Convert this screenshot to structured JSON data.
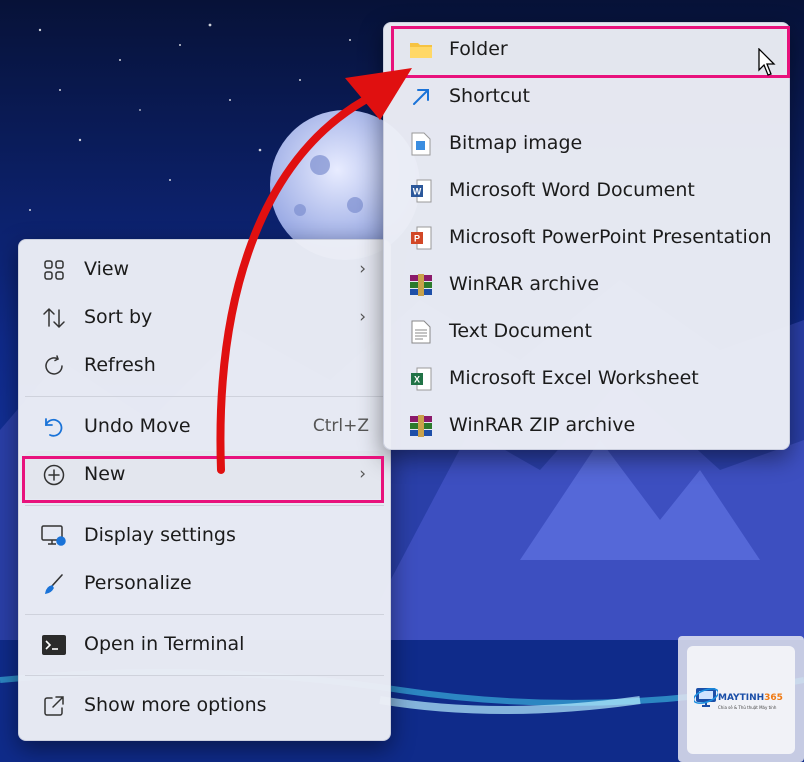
{
  "context_menu": {
    "groups": [
      [
        {
          "label": "View",
          "icon": "grid-icon",
          "has_submenu": true
        },
        {
          "label": "Sort by",
          "icon": "sort-arrows-icon",
          "has_submenu": true
        },
        {
          "label": "Refresh",
          "icon": "refresh-icon",
          "has_submenu": false
        }
      ],
      [
        {
          "label": "Undo Move",
          "icon": "undo-icon",
          "shortcut": "Ctrl+Z"
        },
        {
          "label": "New",
          "icon": "plus-circle-icon",
          "has_submenu": true,
          "highlighted": true
        }
      ],
      [
        {
          "label": "Display settings",
          "icon": "display-settings-icon"
        },
        {
          "label": "Personalize",
          "icon": "brush-icon"
        }
      ],
      [
        {
          "label": "Open in Terminal",
          "icon": "terminal-icon"
        }
      ],
      [
        {
          "label": "Show more options",
          "icon": "external-link-icon"
        }
      ]
    ]
  },
  "new_submenu": {
    "items": [
      {
        "label": "Folder",
        "icon": "folder-icon",
        "highlighted": true
      },
      {
        "label": "Shortcut",
        "icon": "shortcut-arrow-icon"
      },
      {
        "label": "Bitmap image",
        "icon": "bitmap-file-icon"
      },
      {
        "label": "Microsoft Word Document",
        "icon": "word-icon"
      },
      {
        "label": "Microsoft PowerPoint Presentation",
        "icon": "powerpoint-icon"
      },
      {
        "label": "WinRAR archive",
        "icon": "winrar-icon"
      },
      {
        "label": "Text Document",
        "icon": "text-file-icon"
      },
      {
        "label": "Microsoft Excel Worksheet",
        "icon": "excel-icon"
      },
      {
        "label": "WinRAR ZIP archive",
        "icon": "winrar-zip-icon"
      }
    ]
  },
  "watermark": {
    "brand_a": "MAYTINH",
    "brand_b": "365",
    "tagline": "Chia sẻ & Thủ thuật Máy tính"
  },
  "colors": {
    "highlight_border": "#e8127c",
    "arrow": "#e01010",
    "menu_bg": "#eceef6"
  }
}
